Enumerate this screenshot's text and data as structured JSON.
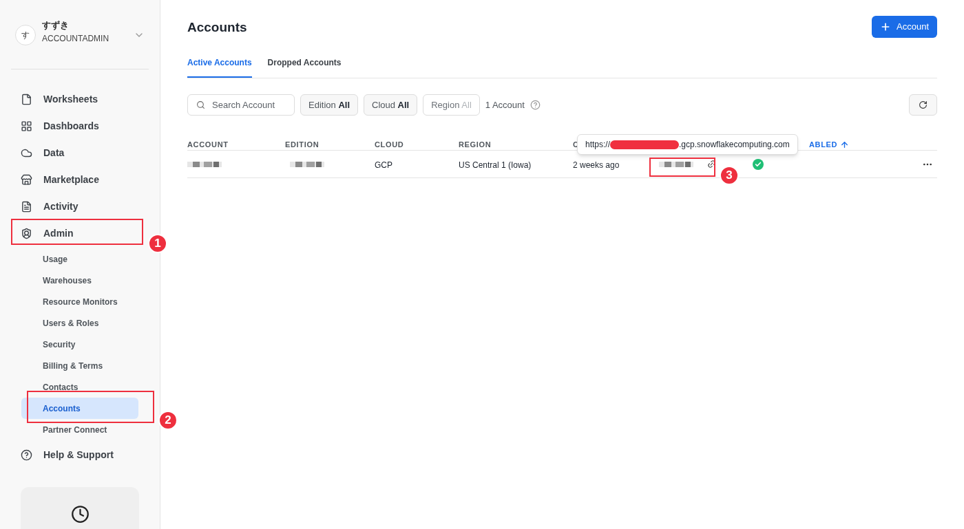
{
  "user": {
    "avatar": "す",
    "name": "すずき",
    "role": "ACCOUNTADMIN"
  },
  "nav": [
    {
      "label": "Worksheets",
      "selected": false
    },
    {
      "label": "Dashboards",
      "selected": false
    },
    {
      "label": "Data",
      "selected": false
    },
    {
      "label": "Marketplace",
      "selected": false
    },
    {
      "label": "Activity",
      "selected": false
    },
    {
      "label": "Admin",
      "selected": false,
      "children": [
        {
          "label": "Usage",
          "selected": false
        },
        {
          "label": "Warehouses",
          "selected": false
        },
        {
          "label": "Resource Monitors",
          "selected": false
        },
        {
          "label": "Users & Roles",
          "selected": false
        },
        {
          "label": "Security",
          "selected": false
        },
        {
          "label": "Billing & Terms",
          "selected": false
        },
        {
          "label": "Contacts",
          "selected": false
        },
        {
          "label": "Accounts",
          "selected": true
        },
        {
          "label": "Partner Connect",
          "selected": false
        }
      ]
    },
    {
      "label": "Help & Support",
      "selected": false
    }
  ],
  "page_title": "Accounts",
  "add_button": "Account",
  "tabs": [
    {
      "label": "Active Accounts",
      "selected": true
    },
    {
      "label": "Dropped Accounts",
      "selected": false
    }
  ],
  "search": {
    "placeholder": "Search Account"
  },
  "filters": [
    {
      "label": "Edition",
      "value": "All",
      "disabled": false
    },
    {
      "label": "Cloud",
      "value": "All",
      "disabled": false
    },
    {
      "label": "Region",
      "value": "All",
      "disabled": true
    }
  ],
  "count": "1 Account",
  "table": {
    "columns": [
      "ACCOUNT",
      "EDITION",
      "CLOUD",
      "REGION",
      "C",
      "ABLED"
    ],
    "rows": [
      {
        "cells": [
          {
            "kind": "redacted"
          },
          {
            "kind": "redacted"
          },
          {
            "kind": "text",
            "text": "GCP"
          },
          {
            "kind": "text",
            "text": "US Central 1 (Iowa)"
          },
          {
            "kind": "text",
            "text": "2 weeks ago"
          },
          {
            "kind": "link"
          },
          {
            "kind": "status",
            "enabled": true
          },
          {
            "kind": "menu"
          }
        ]
      }
    ]
  },
  "tooltip": {
    "prefix": "https://",
    "suffix": ".gcp.snowflakecomputing.com"
  },
  "annotations": [
    "1",
    "2",
    "3"
  ]
}
